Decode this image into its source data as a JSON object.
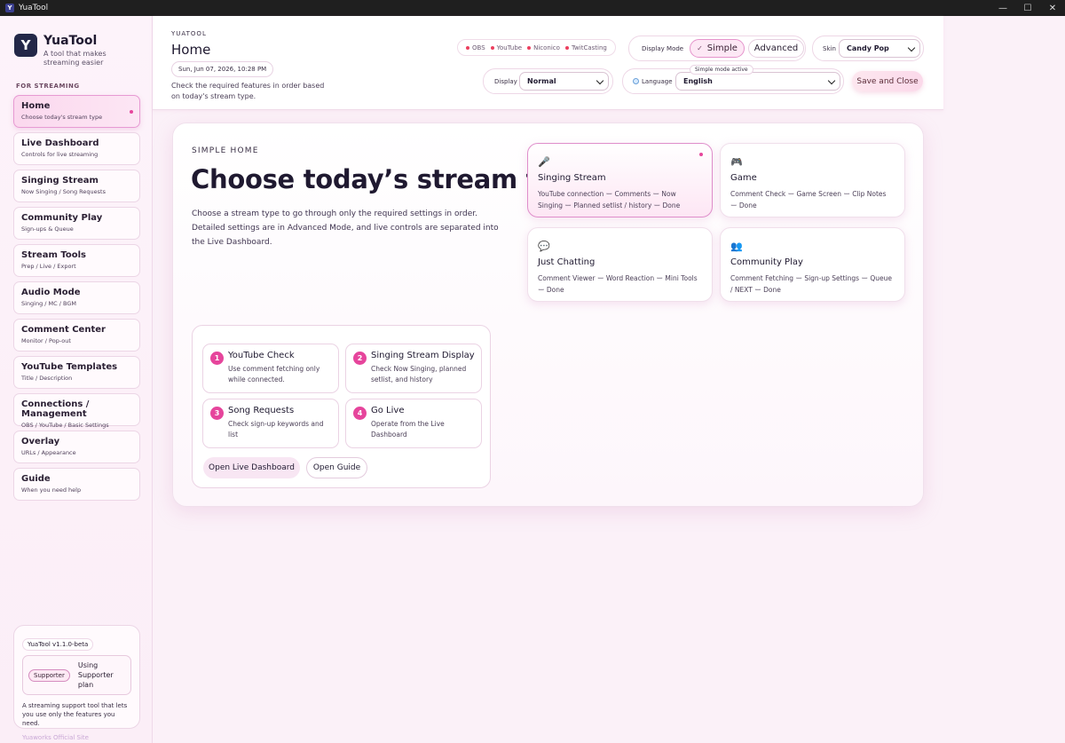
{
  "window": {
    "title": "YuaTool",
    "app_icon": "Y"
  },
  "sidebar": {
    "brand_name": "YuaTool",
    "brand_tagline": "A tool that makes streaming easier",
    "logo_letter": "Y",
    "section_label": "FOR STREAMING",
    "items": [
      {
        "title": "Home",
        "sub": "Choose today's stream type"
      },
      {
        "title": "Live Dashboard",
        "sub": "Controls for live streaming"
      },
      {
        "title": "Singing Stream",
        "sub": "Now Singing / Song Requests"
      },
      {
        "title": "Community Play",
        "sub": "Sign-ups & Queue"
      },
      {
        "title": "Stream Tools",
        "sub": "Prep / Live / Export"
      },
      {
        "title": "Audio Mode",
        "sub": "Singing / MC / BGM"
      },
      {
        "title": "Comment Center",
        "sub": "Monitor / Pop-out"
      },
      {
        "title": "YouTube Templates",
        "sub": "Title / Description"
      },
      {
        "title": "Connections / Management",
        "sub": "OBS / YouTube / Basic Settings"
      },
      {
        "title": "Overlay",
        "sub": "URLs / Appearance"
      },
      {
        "title": "Guide",
        "sub": "When you need help"
      }
    ],
    "footer": {
      "version": "YuaTool v1.1.0-beta",
      "supporter_badge": "Supporter",
      "supporter_text": "Using Supporter plan",
      "description": "A streaming support tool that lets you use only the features you need.",
      "link": "Yuaworks Official Site"
    }
  },
  "header": {
    "kicker": "YUATOOL",
    "title": "Home",
    "date": "Sun, Jun 07, 2026, 10:28 PM",
    "subtitle": "Check the required features in order based on today's stream type.",
    "services": [
      "OBS",
      "YouTube",
      "Niconico",
      "TwitCasting"
    ],
    "service_status_color": "#ec3f5e",
    "display_mode_label": "Display Mode",
    "mode_simple": "Simple",
    "mode_advanced": "Advanced",
    "mode_note": "Simple mode active",
    "skin_label": "Skin",
    "skin_value": "Candy Pop",
    "display_label": "Display",
    "display_value": "Normal",
    "language_label": "Language",
    "language_value": "English",
    "save_button": "Save and Close"
  },
  "main": {
    "kicker": "SIMPLE HOME",
    "title": "Choose today’s stream type",
    "description": "Choose a stream type to go through only the required settings in order. Detailed settings are in Advanced Mode, and live controls are separated into the Live Dashboard.",
    "stream_types": [
      {
        "icon": "microphone-icon",
        "glyph": "🎤",
        "title": "Singing Stream",
        "steps": "YouTube connection ー Comments ー Now Singing ー Planned setlist / history ー Done"
      },
      {
        "icon": "gamepad-icon",
        "glyph": "🎮",
        "title": "Game",
        "steps": "Comment Check ー Game Screen ー Clip Notes ー Done"
      },
      {
        "icon": "chat-bubble-icon",
        "glyph": "💬",
        "title": "Just Chatting",
        "steps": "Comment Viewer ー Word Reaction ー Mini Tools ー Done"
      },
      {
        "icon": "people-icon",
        "glyph": "👥",
        "title": "Community Play",
        "steps": "Comment Fetching ー Sign-up Settings ー Queue / NEXT ー Done"
      }
    ],
    "steps": [
      {
        "num": "1",
        "title": "YouTube Check",
        "desc": "Use comment fetching only while connected."
      },
      {
        "num": "2",
        "title": "Singing Stream Display",
        "desc": "Check Now Singing, planned setlist, and history"
      },
      {
        "num": "3",
        "title": "Song Requests",
        "desc": "Check sign-up keywords and list"
      },
      {
        "num": "4",
        "title": "Go Live",
        "desc": "Operate from the Live Dashboard"
      }
    ],
    "open_dashboard": "Open Live Dashboard",
    "open_guide": "Open Guide"
  },
  "colors": {
    "accent": "#e6459c",
    "brand_dark": "#232848"
  }
}
